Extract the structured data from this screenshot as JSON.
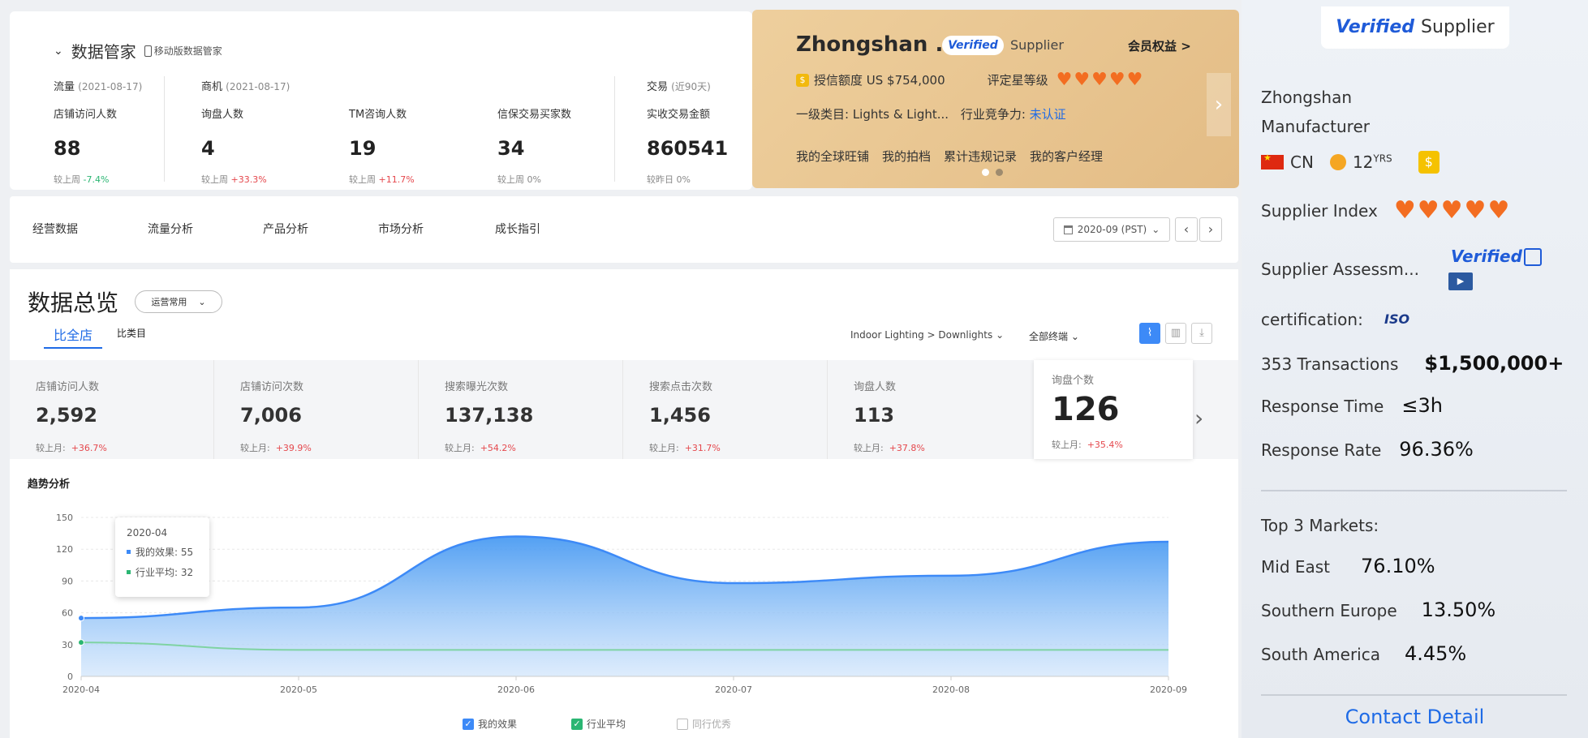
{
  "data_manager": {
    "title": "数据管家",
    "mobile_link": "移动版数据管家"
  },
  "groups": {
    "traffic": {
      "label": "流量",
      "date": "(2021-08-17)"
    },
    "opportunity": {
      "label": "商机",
      "date": "(2021-08-17)"
    },
    "trade": {
      "label": "交易",
      "date": "(近90天)"
    }
  },
  "top_stats": [
    {
      "label": "店铺访问人数",
      "value": "88",
      "cmp_label": "较上周",
      "cmp_value": "-7.4%"
    },
    {
      "label": "询盘人数",
      "value": "4",
      "cmp_label": "较上周",
      "cmp_value": "+33.3%"
    },
    {
      "label": "TM咨询人数",
      "value": "19",
      "cmp_label": "较上周",
      "cmp_value": "+11.7%"
    },
    {
      "label": "信保交易买家数",
      "value": "34",
      "cmp_label": "较上周",
      "cmp_value": "0%"
    },
    {
      "label": "实收交易金额",
      "value": "860541",
      "cmp_label": "较昨日",
      "cmp_value": "0%"
    }
  ],
  "banner": {
    "company": "Zhongshan ...",
    "verified": "Verified",
    "supplier": "Supplier",
    "member_link": "会员权益 >",
    "credit_label": "授信额度 US $754,000",
    "rating_label": "评定星等级",
    "category": "一级类目: Lights & Light...",
    "competitiveness_label": "行业竞争力:",
    "competitiveness_value": "未认证",
    "links": [
      "我的全球旺铺",
      "我的拍档",
      "累计违规记录",
      "我的客户经理"
    ]
  },
  "tabs": [
    "经营数据",
    "流量分析",
    "产品分析",
    "市场分析",
    "成长指引"
  ],
  "date_selector": "2020-09 (PST)",
  "overview": {
    "title": "数据总览",
    "select": "运营常用",
    "compare_tabs": [
      "比全店",
      "比类目"
    ],
    "category_filter": "Indoor Lighting > Downlights",
    "terminal_filter": "全部终端"
  },
  "metrics": [
    {
      "label": "店铺访问人数",
      "value": "2,592",
      "cmp_label": "较上月:",
      "cmp_value": "+36.7%"
    },
    {
      "label": "店铺访问次数",
      "value": "7,006",
      "cmp_label": "较上月:",
      "cmp_value": "+39.9%"
    },
    {
      "label": "搜索曝光次数",
      "value": "137,138",
      "cmp_label": "较上月:",
      "cmp_value": "+54.2%"
    },
    {
      "label": "搜索点击次数",
      "value": "1,456",
      "cmp_label": "较上月:",
      "cmp_value": "+31.7%"
    },
    {
      "label": "询盘人数",
      "value": "113",
      "cmp_label": "较上月:",
      "cmp_value": "+37.8%"
    },
    {
      "label": "询盘个数",
      "value": "126",
      "cmp_label": "较上月:",
      "cmp_value": "+35.4%"
    }
  ],
  "trend_title": "趋势分析",
  "tooltip": {
    "date": "2020-04",
    "mine": "我的效果: 55",
    "industry": "行业平均: 32"
  },
  "legend": [
    "我的效果",
    "行业平均",
    "同行优秀"
  ],
  "chart_data": {
    "type": "area",
    "categories": [
      "2020-04",
      "2020-05",
      "2020-06",
      "2020-07",
      "2020-08",
      "2020-09"
    ],
    "series": [
      {
        "name": "我的效果",
        "values": [
          55,
          65,
          132,
          88,
          95,
          127
        ],
        "color": "#3d8af7"
      },
      {
        "name": "行业平均",
        "values": [
          32,
          25,
          25,
          25,
          25,
          25
        ],
        "color": "#2bb673"
      }
    ],
    "ylim": [
      0,
      150
    ],
    "yticks": [
      0,
      30,
      60,
      90,
      120,
      150
    ]
  },
  "right_panel": {
    "verified": "Verified",
    "supplier": "Supplier",
    "company_line1": "Zhongshan",
    "company_line2": "Manufacturer",
    "country": "CN",
    "years": "12",
    "years_suffix": "YRS",
    "supplier_index_label": "Supplier Index",
    "assessment_label": "Supplier Assessm...",
    "assessment_badge": "Verified",
    "certification_label": "certification:",
    "cert_badge": "ISO",
    "transactions_label": "353 Transactions",
    "transactions_value": "$1,500,000+",
    "response_time_label": "Response Time",
    "response_time_value": "≤3h",
    "response_rate_label": "Response Rate",
    "response_rate_value": "96.36%",
    "top_markets_label": "Top 3 Markets:",
    "markets": [
      {
        "name": "Mid East",
        "value": "76.10%"
      },
      {
        "name": "Southern Europe",
        "value": "13.50%"
      },
      {
        "name": "South America",
        "value": "4.45%"
      }
    ],
    "contact": "Contact Detail"
  },
  "colors": {
    "accent_blue": "#1f6be6",
    "rating_orange": "#f36d21",
    "gold": "#e3bc85"
  }
}
